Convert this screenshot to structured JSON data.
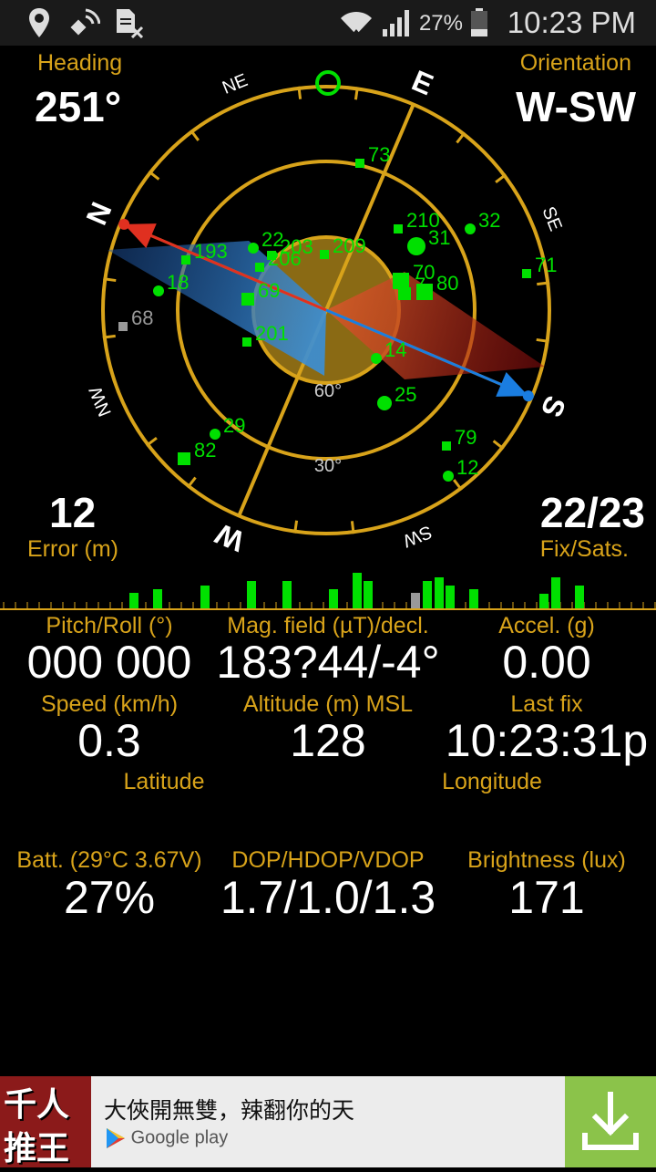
{
  "status_bar": {
    "battery": "27%",
    "time": "10:23 PM"
  },
  "heading": {
    "label": "Heading",
    "value": "251°"
  },
  "orientation": {
    "label": "Orientation",
    "value": "W-SW"
  },
  "error": {
    "label": "Error (m)",
    "value": "12"
  },
  "fix": {
    "label": "Fix/Sats.",
    "value": "22/23"
  },
  "compass": {
    "cardinals": [
      "W",
      "S",
      "N",
      "E"
    ],
    "intercardinals": [
      "SW",
      "NW",
      "SE",
      "NE"
    ],
    "elevation_labels": [
      "60°",
      "30°"
    ],
    "satellites": [
      {
        "id": "73",
        "shape": "square",
        "color": "#00e000"
      },
      {
        "id": "210",
        "shape": "square",
        "color": "#00e000"
      },
      {
        "id": "31",
        "shape": "circle",
        "color": "#00e000"
      },
      {
        "id": "32",
        "shape": "circle",
        "color": "#00e000"
      },
      {
        "id": "71",
        "shape": "square",
        "color": "#00e000"
      },
      {
        "id": "22",
        "shape": "circle",
        "color": "#00e000"
      },
      {
        "id": "203",
        "shape": "square",
        "color": "#00e000"
      },
      {
        "id": "209",
        "shape": "square",
        "color": "#00e000"
      },
      {
        "id": "206",
        "shape": "square",
        "color": "#00e000"
      },
      {
        "id": "193",
        "shape": "square",
        "color": "#00e000"
      },
      {
        "id": "18",
        "shape": "circle",
        "color": "#00e000"
      },
      {
        "id": "69",
        "shape": "square",
        "color": "#00e000"
      },
      {
        "id": "70",
        "shape": "square",
        "color": "#00e000"
      },
      {
        "id": "80",
        "shape": "square",
        "color": "#00e000"
      },
      {
        "id": "7",
        "shape": "square",
        "color": "#00e000"
      },
      {
        "id": "68",
        "shape": "square",
        "color": "#999999"
      },
      {
        "id": "201",
        "shape": "square",
        "color": "#00e000"
      },
      {
        "id": "14",
        "shape": "circle",
        "color": "#00e000"
      },
      {
        "id": "25",
        "shape": "circle",
        "color": "#00e000"
      },
      {
        "id": "29",
        "shape": "circle",
        "color": "#00e000"
      },
      {
        "id": "82",
        "shape": "square",
        "color": "#00e000"
      },
      {
        "id": "79",
        "shape": "square",
        "color": "#00e000"
      },
      {
        "id": "12",
        "shape": "circle",
        "color": "#00e000"
      }
    ]
  },
  "signal_bars": [
    {
      "level": 0.36,
      "color": "#00e000"
    },
    {
      "level": 0.44,
      "color": "#00e000"
    },
    {
      "level": 0.52,
      "color": "#00e000"
    },
    {
      "level": 0.62,
      "color": "#00e000"
    },
    {
      "level": 0.62,
      "color": "#00e000"
    },
    {
      "level": 0.44,
      "color": "#00e000"
    },
    {
      "level": 0.8,
      "color": "#00e000"
    },
    {
      "level": 0.62,
      "color": "#00e000"
    },
    {
      "level": 0.36,
      "color": "#999999"
    },
    {
      "level": 0.62,
      "color": "#00e000"
    },
    {
      "level": 0.7,
      "color": "#00e000"
    },
    {
      "level": 0.52,
      "color": "#00e000"
    },
    {
      "level": 0.44,
      "color": "#00e000"
    },
    {
      "level": 0.34,
      "color": "#00e000"
    },
    {
      "level": 0.7,
      "color": "#00e000"
    },
    {
      "level": 0.52,
      "color": "#00e000"
    }
  ],
  "metrics": {
    "pitch_roll": {
      "label": "Pitch/Roll (°)",
      "value": "000 000"
    },
    "mag_field": {
      "label": "Mag. field (µT)/decl.",
      "value": "183?44/-4°"
    },
    "accel": {
      "label": "Accel. (g)",
      "value": "0.00"
    },
    "speed": {
      "label": "Speed (km/h)",
      "value": "0.3"
    },
    "altitude": {
      "label": "Altitude (m) MSL",
      "value": "128"
    },
    "last_fix": {
      "label": "Last fix",
      "value": "10:23:31p"
    },
    "latitude": {
      "label": "Latitude"
    },
    "longitude": {
      "label": "Longitude"
    },
    "battery": {
      "label": "Batt. (29°C 3.67V)",
      "value": "27%"
    },
    "dop": {
      "label": "DOP/HDOP/VDOP",
      "value": "1.7/1.0/1.3"
    },
    "brightness": {
      "label": "Brightness (lux)",
      "value": "171"
    }
  },
  "ad": {
    "thumb_text": [
      "千人",
      "推王"
    ],
    "title": "大俠開無雙，辣翻你的天",
    "store": "Google play"
  },
  "colors": {
    "accent": "#d8a31a",
    "satellite_used": "#00e000",
    "satellite_unused": "#999999",
    "pointer_north": "#e03020",
    "pointer_south": "#1a7de0"
  }
}
